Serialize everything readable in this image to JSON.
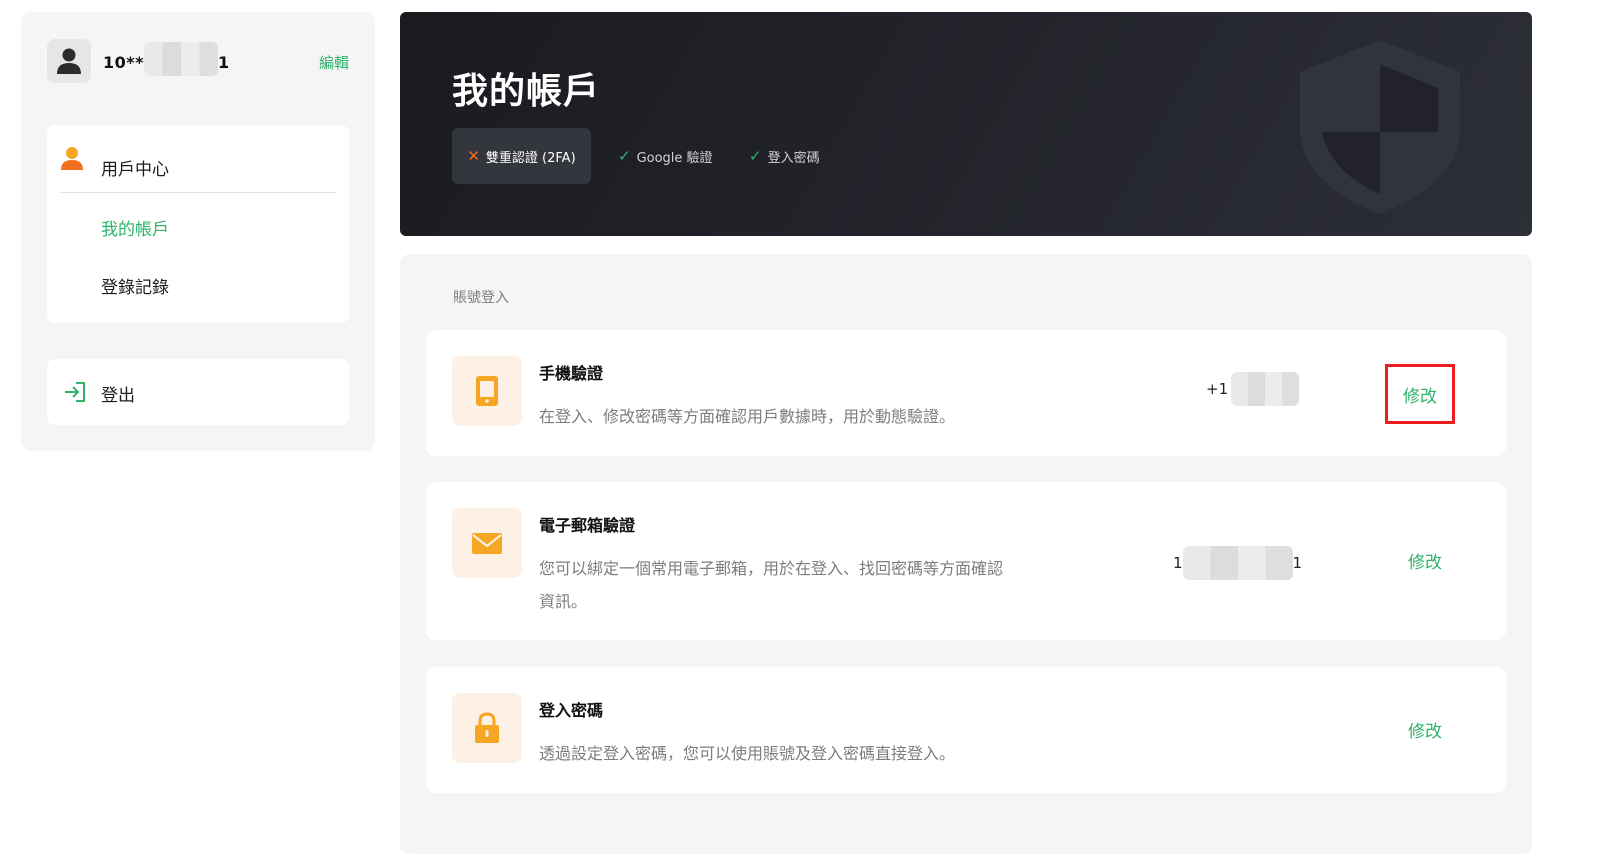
{
  "sidebar": {
    "username_prefix": "10**",
    "username_suffix": "1",
    "edit_label": "編輯",
    "menu": {
      "head_label": "用戶中心",
      "items": [
        {
          "label": "我的帳戶",
          "active": true
        },
        {
          "label": "登錄記錄",
          "active": false
        }
      ]
    },
    "logout_label": "登出"
  },
  "hero": {
    "title": "我的帳戶",
    "chips": [
      {
        "label": "雙重認證 (2FA)",
        "status": "x"
      },
      {
        "label": "Google 驗證",
        "status": "check"
      },
      {
        "label": "登入密碼",
        "status": "check"
      }
    ]
  },
  "section": {
    "title": "賬號登入",
    "methods": [
      {
        "title": "手機驗證",
        "desc": "在登入、修改密碼等方面確認用戶數據時，用於動態驗證。",
        "value_prefix": "+1",
        "value_suffix": "",
        "action": "修改",
        "icon": "phone-icon"
      },
      {
        "title": "電子郵箱驗證",
        "desc": "您可以綁定一個常用電子郵箱，用於在登入、找回密碼等方面確認資訊。",
        "value_prefix": "1",
        "value_suffix": "1",
        "action": "修改",
        "icon": "envelope-icon"
      },
      {
        "title": "登入密碼",
        "desc": "透過設定登入密碼，您可以使用賬號及登入密碼直接登入。",
        "action": "修改",
        "icon": "lock-icon"
      }
    ]
  },
  "colors": {
    "accent": "#2fb36b",
    "warning": "#f0701f",
    "highlight_border": "#ee1c1c",
    "hero_bg": "#1f2026"
  }
}
